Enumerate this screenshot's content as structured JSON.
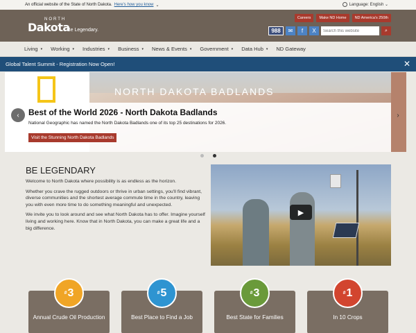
{
  "gov_banner": {
    "text": "An official website of the State of North Dakota.",
    "link": "Here's how you know",
    "caret": "⌄"
  },
  "header": {
    "logo_north": "NORTH",
    "logo_dakota": "Dakota",
    "tagline": "Be Legendary.",
    "language_label": "Language: English ⌄",
    "quick_links": [
      "Careers",
      "Make ND Home",
      "ND America's 250th"
    ],
    "badge_988": "988",
    "email_icon": "✉",
    "facebook_icon": "f",
    "x_icon": "X",
    "search_placeholder": "Search this website",
    "search_icon": "⌕"
  },
  "nav": [
    {
      "label": "Living",
      "dropdown": true
    },
    {
      "label": "Working",
      "dropdown": true
    },
    {
      "label": "Industries",
      "dropdown": true
    },
    {
      "label": "Business",
      "dropdown": true
    },
    {
      "label": "News & Events",
      "dropdown": true
    },
    {
      "label": "Government",
      "dropdown": true
    },
    {
      "label": "Data Hub",
      "dropdown": true
    },
    {
      "label": "ND Gateway",
      "dropdown": false
    }
  ],
  "nav_caret": "▾",
  "alert": {
    "text": "Global Talent Summit - Registration Now Open!",
    "close": "✕"
  },
  "hero": {
    "overlay_text": "NORTH DAKOTA BADLANDS",
    "title": "Best of the World 2026 - North Dakota Badlands",
    "description": "National Geographic has named the North Dakota Badlands one of its top 25 destinations for 2026.",
    "cta": "Visit the Stunning North Dakota Badlands",
    "prev": "‹",
    "next": "›"
  },
  "intro": {
    "heading": "BE LEGENDARY",
    "p1": "Welcome to North Dakota where possibility is as endless as the horizon.",
    "p2": "Whether you crave the rugged outdoors or thrive in urban settings, you'll find vibrant, diverse communities and the shortest average commute time in the country, leaving you with even more time to do something meaningful and unexpected.",
    "p3": "We invite you to look around and see what North Dakota has to offer. Imagine yourself living and working here. Know that in North Dakota, you can make a great life and a big difference."
  },
  "video": {
    "play_icon": "▶"
  },
  "stats": [
    {
      "rank": "3",
      "label": "Annual Crude Oil Production",
      "color": "#f0a526"
    },
    {
      "rank": "5",
      "label": "Best Place to Find a Job",
      "color": "#2e94d1"
    },
    {
      "rank": "3",
      "label": "Best State for Families",
      "color": "#6a9a3a"
    },
    {
      "rank": "1",
      "label": "In 10 Crops",
      "color": "#d2452f"
    }
  ],
  "rank_prefix": "#"
}
